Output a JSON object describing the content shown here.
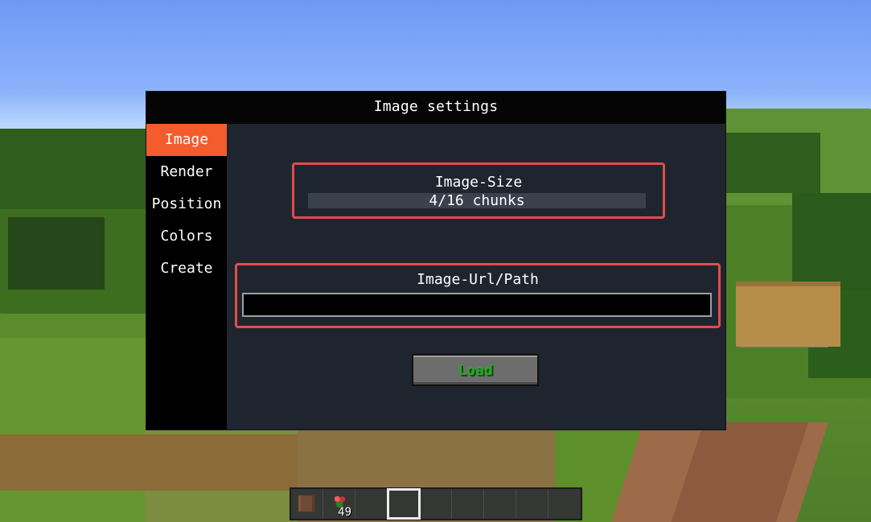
{
  "dialog": {
    "title": "Image settings"
  },
  "sidebar": {
    "items": [
      {
        "label": "Image"
      },
      {
        "label": "Render"
      },
      {
        "label": "Position"
      },
      {
        "label": "Colors"
      },
      {
        "label": "Create"
      }
    ],
    "active_index": 0
  },
  "image_size": {
    "label": "Image-Size",
    "value": "4/16 chunks",
    "current": 4,
    "max": 16
  },
  "image_path": {
    "label": "Image-Url/Path",
    "value": "",
    "placeholder": ""
  },
  "actions": {
    "load_label": "Load"
  },
  "hotbar": {
    "selected_index": 3,
    "slots": [
      {
        "item": "dirt-block-icon",
        "count": ""
      },
      {
        "item": "flower-icon",
        "count": "49"
      },
      {
        "item": "",
        "count": ""
      },
      {
        "item": "",
        "count": ""
      },
      {
        "item": "",
        "count": ""
      },
      {
        "item": "",
        "count": ""
      },
      {
        "item": "",
        "count": ""
      },
      {
        "item": "",
        "count": ""
      },
      {
        "item": "",
        "count": ""
      }
    ]
  },
  "colors": {
    "active_tab": "#f45c2d",
    "dialog_background": "#1f252e",
    "sidebar_background": "#000000",
    "highlight_border": "#e34b4b",
    "load_text": "#23ad23"
  }
}
